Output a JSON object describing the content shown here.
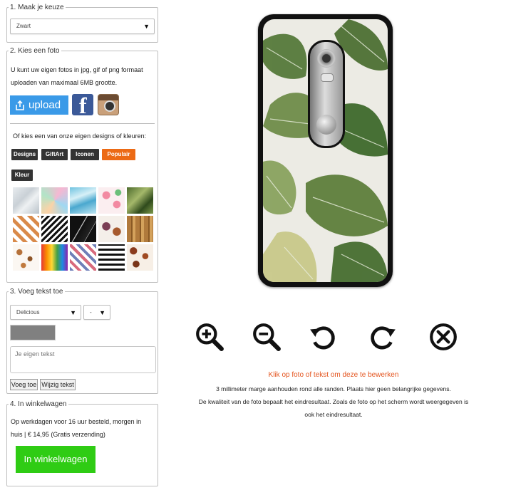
{
  "step1": {
    "legend": "1. Maak je keuze",
    "selected_color": "Zwart"
  },
  "step2": {
    "legend": "2. Kies een foto",
    "description": "U kunt uw eigen fotos in jpg, gif of png formaat uploaden van maximaal 6MB grootte.",
    "upload_label": "upload",
    "designs_intro": "Of kies een van onze eigen designs of kleuren:",
    "categories": [
      {
        "label": "Designs",
        "active": false
      },
      {
        "label": "GiftArt",
        "active": false
      },
      {
        "label": "Iconen",
        "active": false
      },
      {
        "label": "Populair",
        "active": true
      },
      {
        "label": "Kleur",
        "active": false
      }
    ],
    "thumbnails": [
      "marble-white",
      "pastel-triangles",
      "blue-marble",
      "flamingos",
      "palm-leaves",
      "copper-triangles",
      "zigzag-black",
      "black-marble",
      "autumn-leaves",
      "bamboo",
      "feathers",
      "rainbow-drips",
      "chevron-multicolor",
      "brush-stripes",
      "leopard-spots"
    ]
  },
  "step3": {
    "legend": "3. Voeg tekst toe",
    "font_value": "Delicious",
    "size_value": "-",
    "text_placeholder": "Je eigen tekst",
    "add_button": "Voeg toe",
    "edit_button": "Wijzig tekst",
    "swatch_color": "#808080"
  },
  "step4": {
    "legend": "4. In winkelwagen",
    "delivery_text": "Op werkdagen voor 16 uur besteld, morgen in huis | € 14,95 (Gratis verzending)",
    "cart_button": "In winkelwagen",
    "cart_color": "#2fcc14"
  },
  "preview": {
    "icons": [
      "zoom-in-icon",
      "zoom-out-icon",
      "rotate-left-icon",
      "rotate-right-icon",
      "delete-icon"
    ],
    "click_hint": "Klik op foto of tekst om deze te bewerken",
    "margin_note": "3 millimeter marge aanhouden rond alle randen. Plaats hier geen belangrijke gegevens.",
    "quality_note_1": "De kwaliteit van de foto bepaalt het eindresultaat. Zoals de foto op het scherm wordt weergegeven is",
    "quality_note_2": "ook het eindresultaat."
  },
  "colors": {
    "accent_orange": "#ec6a15",
    "upload_blue": "#3a9ae8",
    "facebook_blue": "#3b5998"
  }
}
